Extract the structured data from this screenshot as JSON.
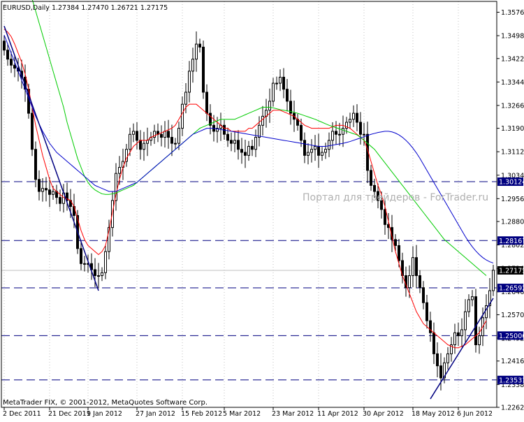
{
  "header": {
    "symbol": "EURUSD,Daily",
    "ohlc": "1.27384 1.27470 1.26721 1.27175"
  },
  "watermark": "Портал для трейдеров - ForTrader.ru",
  "footer": "MetaTrader FIX, © 2001-2012, MetaQuotes Software Corp.",
  "colors": {
    "background": "#ffffff",
    "candles": "#000000",
    "grid": "#c0c0c0",
    "ma_fast": "#ff0000",
    "ma_mid": "#00cc00",
    "ma_slow": "#0000cc",
    "level_line": "#000080",
    "label_bg": "#000080",
    "current_label_bg": "#000000",
    "watermark": "#b0b0b0"
  },
  "chart_data": {
    "type": "candlestick",
    "y_range": [
      1.2262,
      1.3612
    ],
    "y_ticks": [
      "1.35760",
      "1.34980",
      "1.34220",
      "1.33440",
      "1.32660",
      "1.31900",
      "1.31120",
      "1.30340",
      "1.29560",
      "1.28800",
      "1.28020",
      "1.27240",
      "1.26460",
      "1.25700",
      "1.24920",
      "1.24160",
      "1.23380",
      "1.22620"
    ],
    "x_ticks": [
      {
        "label": "2 Dec 2011",
        "index": 0
      },
      {
        "label": "21 Dec 2011",
        "index": 13
      },
      {
        "label": "9 Jan 2012",
        "index": 24
      },
      {
        "label": "27 Jan 2012",
        "index": 38
      },
      {
        "label": "15 Feb 2012",
        "index": 51
      },
      {
        "label": "5 Mar 2012",
        "index": 63
      },
      {
        "label": "23 Mar 2012",
        "index": 77
      },
      {
        "label": "11 Apr 2012",
        "index": 90
      },
      {
        "label": "30 Apr 2012",
        "index": 103
      },
      {
        "label": "18 May 2012",
        "index": 117
      },
      {
        "label": "6 Jun 2012",
        "index": 130
      }
    ],
    "close": [
      1.345,
      1.342,
      1.34,
      1.339,
      1.338,
      1.336,
      1.332,
      1.324,
      1.312,
      1.302,
      1.298,
      1.299,
      1.2985,
      1.297,
      1.298,
      1.296,
      1.294,
      1.2975,
      1.295,
      1.293,
      1.29,
      1.279,
      1.274,
      1.274,
      1.274,
      1.272,
      1.27,
      1.27,
      1.271,
      1.278,
      1.286,
      1.295,
      1.304,
      1.306,
      1.308,
      1.312,
      1.317,
      1.318,
      1.315,
      1.312,
      1.314,
      1.315,
      1.316,
      1.318,
      1.317,
      1.316,
      1.318,
      1.316,
      1.314,
      1.314,
      1.319,
      1.327,
      1.331,
      1.338,
      1.342,
      1.347,
      1.346,
      1.331,
      1.324,
      1.32,
      1.318,
      1.319,
      1.32,
      1.317,
      1.315,
      1.314,
      1.315,
      1.312,
      1.311,
      1.31,
      1.313,
      1.312,
      1.316,
      1.32,
      1.323,
      1.325,
      1.328,
      1.334,
      1.334,
      1.336,
      1.332,
      1.328,
      1.324,
      1.322,
      1.32,
      1.315,
      1.31,
      1.311,
      1.312,
      1.313,
      1.31,
      1.311,
      1.312,
      1.315,
      1.318,
      1.317,
      1.317,
      1.319,
      1.321,
      1.322,
      1.324,
      1.321,
      1.317,
      1.317,
      1.305,
      1.3,
      1.298,
      1.295,
      1.292,
      1.287,
      1.286,
      1.282,
      1.28,
      1.275,
      1.27,
      1.266,
      1.27,
      1.276,
      1.27,
      1.266,
      1.261,
      1.255,
      1.251,
      1.244,
      1.24,
      1.236,
      1.241,
      1.244,
      1.247,
      1.251,
      1.25,
      1.252,
      1.258,
      1.262,
      1.263,
      1.247,
      1.25,
      1.256,
      1.26,
      1.265,
      1.2718
    ],
    "series": [
      {
        "name": "",
        "values": [
          1.352,
          1.351,
          1.3495,
          1.347,
          1.344,
          1.341,
          1.337,
          1.332,
          1.326,
          1.32,
          1.315,
          1.31,
          1.306,
          1.302,
          1.299,
          1.298,
          1.297,
          1.296,
          1.2955,
          1.295,
          1.293,
          1.289,
          1.285,
          1.282,
          1.28,
          1.279,
          1.278,
          1.277,
          1.278,
          1.28,
          1.285,
          1.291,
          1.297,
          1.302,
          1.306,
          1.309,
          1.311,
          1.313,
          1.314,
          1.315,
          1.315,
          1.315,
          1.316,
          1.3165,
          1.317,
          1.3175,
          1.318,
          1.3185,
          1.319,
          1.32,
          1.322,
          1.324,
          1.326,
          1.327,
          1.327,
          1.327,
          1.326,
          1.325,
          1.324,
          1.323,
          1.322,
          1.321,
          1.32,
          1.319,
          1.319,
          1.318,
          1.318,
          1.318,
          1.318,
          1.318,
          1.319,
          1.319,
          1.32,
          1.321,
          1.322,
          1.323,
          1.324,
          1.325,
          1.325,
          1.325,
          1.3245,
          1.324,
          1.3235,
          1.323,
          1.322,
          1.321,
          1.32,
          1.3195,
          1.319,
          1.319,
          1.319,
          1.319,
          1.319,
          1.319,
          1.3195,
          1.32,
          1.32,
          1.32,
          1.3195,
          1.319,
          1.318,
          1.317,
          1.316,
          1.315,
          1.312,
          1.308,
          1.304,
          1.3,
          1.297,
          1.293,
          1.288,
          1.283,
          1.278,
          1.274,
          1.27,
          1.267,
          1.264,
          1.261,
          1.258,
          1.256,
          1.254,
          1.253,
          1.252,
          1.251,
          1.25,
          1.249,
          1.248,
          1.247,
          1.2465,
          1.246,
          1.246,
          1.2465,
          1.247,
          1.248,
          1.249,
          1.25,
          1.251,
          1.253,
          1.255
        ]
      },
      {
        "name": "",
        "values": [
          1.39,
          1.387,
          1.384,
          1.381,
          1.378,
          1.374,
          1.37,
          1.366,
          1.362,
          1.358,
          1.354,
          1.35,
          1.346,
          1.342,
          1.338,
          1.334,
          1.33,
          1.326,
          1.321,
          1.317,
          1.313,
          1.309,
          1.306,
          1.303,
          1.301,
          1.2995,
          1.2985,
          1.2978,
          1.2972,
          1.297,
          1.297,
          1.2972,
          1.2975,
          1.298,
          1.2985,
          1.299,
          1.2995,
          1.3,
          1.301,
          1.302,
          1.303,
          1.304,
          1.305,
          1.306,
          1.307,
          1.308,
          1.309,
          1.31,
          1.311,
          1.312,
          1.313,
          1.314,
          1.315,
          1.316,
          1.317,
          1.318,
          1.319,
          1.3195,
          1.32,
          1.3205,
          1.321,
          1.3215,
          1.322,
          1.322,
          1.322,
          1.322,
          1.322,
          1.3225,
          1.323,
          1.3235,
          1.324,
          1.3245,
          1.325,
          1.3255,
          1.326,
          1.326,
          1.326,
          1.3258,
          1.3255,
          1.3252,
          1.325,
          1.3248,
          1.3246,
          1.3243,
          1.324,
          1.3236,
          1.3232,
          1.3228,
          1.3224,
          1.322,
          1.3215,
          1.321,
          1.3205,
          1.32,
          1.3196,
          1.3192,
          1.3188,
          1.3184,
          1.318,
          1.3176,
          1.3172,
          1.3168,
          1.316,
          1.315,
          1.314,
          1.313,
          1.312,
          1.3105,
          1.309,
          1.3075,
          1.306,
          1.3045,
          1.303,
          1.3015,
          1.3,
          1.2985,
          1.297,
          1.2955,
          1.294,
          1.2925,
          1.291,
          1.2895,
          1.288,
          1.2865,
          1.285,
          1.2835,
          1.282,
          1.281,
          1.28,
          1.279,
          1.278,
          1.277,
          1.276,
          1.275,
          1.274,
          1.273,
          1.272,
          1.271,
          1.27
        ]
      },
      {
        "name": "",
        "values": [
          1.35,
          1.347,
          1.344,
          1.341,
          1.338,
          1.335,
          1.332,
          1.329,
          1.326,
          1.323,
          1.3205,
          1.318,
          1.316,
          1.314,
          1.3125,
          1.311,
          1.31,
          1.309,
          1.308,
          1.307,
          1.306,
          1.305,
          1.304,
          1.303,
          1.302,
          1.301,
          1.3,
          1.2995,
          1.299,
          1.2985,
          1.298,
          1.298,
          1.298,
          1.2985,
          1.299,
          1.2995,
          1.3,
          1.3005,
          1.301,
          1.302,
          1.303,
          1.304,
          1.305,
          1.306,
          1.307,
          1.308,
          1.309,
          1.31,
          1.311,
          1.312,
          1.313,
          1.314,
          1.315,
          1.316,
          1.317,
          1.3175,
          1.318,
          1.3185,
          1.319,
          1.319,
          1.319,
          1.3188,
          1.3186,
          1.3184,
          1.3182,
          1.318,
          1.3178,
          1.3176,
          1.3174,
          1.3172,
          1.317,
          1.3168,
          1.3166,
          1.3164,
          1.3162,
          1.316,
          1.3158,
          1.3156,
          1.3154,
          1.3152,
          1.315,
          1.3148,
          1.3146,
          1.3144,
          1.3142,
          1.314,
          1.3138,
          1.3136,
          1.3134,
          1.3132,
          1.313,
          1.313,
          1.313,
          1.3132,
          1.3134,
          1.3136,
          1.3138,
          1.314,
          1.3143,
          1.3146,
          1.315,
          1.3154,
          1.3158,
          1.3162,
          1.3166,
          1.317,
          1.3173,
          1.3176,
          1.3178,
          1.318,
          1.318,
          1.3178,
          1.3174,
          1.3168,
          1.316,
          1.315,
          1.3138,
          1.3124,
          1.3108,
          1.309,
          1.307,
          1.305,
          1.303,
          1.301,
          1.299,
          1.297,
          1.295,
          1.293,
          1.291,
          1.289,
          1.287,
          1.285,
          1.283,
          1.2812,
          1.2796,
          1.2782,
          1.277,
          1.276,
          1.2752,
          1.2746,
          1.2742
        ]
      }
    ],
    "levels": [
      {
        "label": "1.30124",
        "value": 1.30124
      },
      {
        "label": "1.28167",
        "value": 1.28167
      },
      {
        "label": "1.26592",
        "value": 1.26592
      },
      {
        "label": "1.25006",
        "value": 1.25006
      },
      {
        "label": "1.23531",
        "value": 1.23531
      }
    ],
    "current_price": {
      "label": "1.27175",
      "value": 1.27175
    },
    "trendlines": [
      {
        "from": {
          "index": 0,
          "value": 1.353
        },
        "to": {
          "index": 27,
          "value": 1.265
        }
      },
      {
        "from": {
          "index": 122,
          "value": 1.229
        },
        "to": {
          "index": 140,
          "value": 1.2625
        }
      }
    ]
  }
}
